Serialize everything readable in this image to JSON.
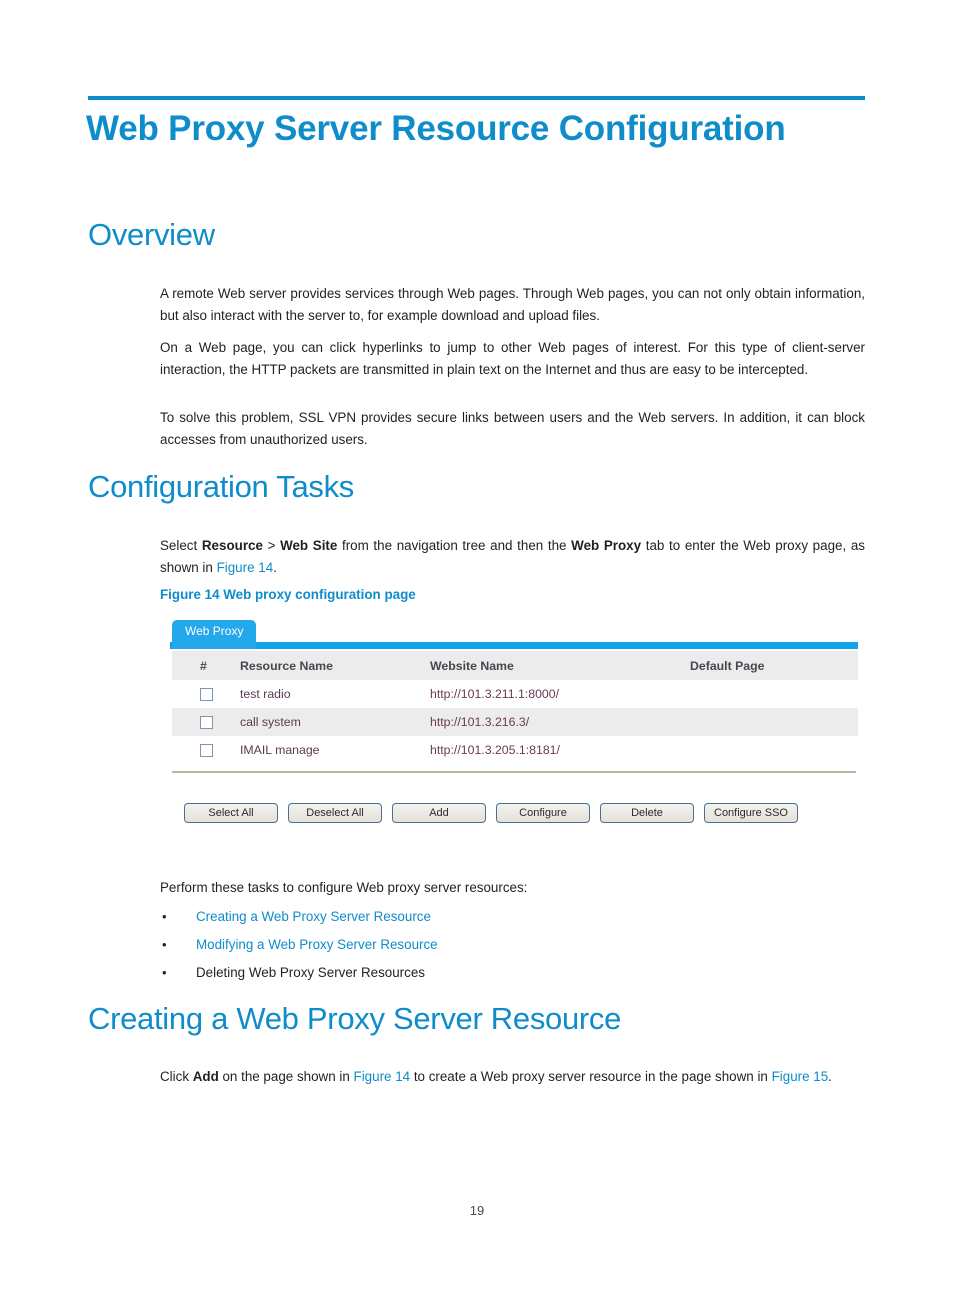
{
  "document": {
    "chapter_title": "Web Proxy Server Resource Configuration",
    "page_number": "19",
    "accent_color": "#0f8cca",
    "body_color": "#231f20"
  },
  "sections": {
    "overview": {
      "heading": "Overview",
      "paragraph_1": "A remote Web server provides services through Web pages. Through Web pages, you can not only obtain information, but also interact with the server to, for example download and upload files.",
      "paragraph_2": "On a Web page, you can click hyperlinks to jump to other Web pages of interest. For this type of client-server interaction, the HTTP packets are transmitted in plain text on the Internet and thus are easy to be intercepted.",
      "paragraph_3": "To solve this problem, SSL VPN provides secure links between users and the Web servers. In addition, it can block accesses from unauthorized users."
    },
    "configuration_tasks": {
      "heading": "Configuration Tasks",
      "intro_prefix": "Select ",
      "intro_bold_1": "Resource",
      "intro_sep": " > ",
      "intro_bold_2": "Web Site",
      "intro_mid": " from the navigation tree and then the ",
      "intro_bold_3": "Web Proxy",
      "intro_suffix": " tab to enter the Web proxy page, as shown in ",
      "intro_xref": "Figure 14",
      "intro_end": ".",
      "figure_caption": "Figure 14 Web proxy configuration page",
      "perform_text": "Perform these tasks to configure Web proxy server resources:",
      "task_links": [
        {
          "label": "Creating a Web Proxy Server Resource",
          "is_link": true
        },
        {
          "label": "Modifying a Web Proxy Server Resource",
          "is_link": true
        },
        {
          "label": "Deleting Web Proxy Server Resources",
          "is_link": false
        }
      ],
      "bullet_glyph": "•"
    },
    "creating": {
      "heading": "Creating a Web Proxy Server Resource",
      "body_prefix": "Click ",
      "body_bold": "Add",
      "body_mid": " on the page shown in ",
      "body_xref_1": "Figure 14",
      "body_mid_2": " to create a Web proxy server resource in the page shown in ",
      "body_xref_2": "Figure 15",
      "body_end": "."
    }
  },
  "figure": {
    "tab_label": "Web Proxy",
    "tab_color": "#23a8ec",
    "bar_color": "#13a3eb",
    "columns": [
      "#",
      "Resource Name",
      "Website Name",
      "Default Page"
    ],
    "rows": [
      {
        "checked": false,
        "resource_name": "test radio",
        "website_name": "http://101.3.211.1:8000/",
        "default_page": ""
      },
      {
        "checked": false,
        "resource_name": "call system",
        "website_name": "http://101.3.216.3/",
        "default_page": ""
      },
      {
        "checked": false,
        "resource_name": "IMAIL manage",
        "website_name": "http://101.3.205.1:8181/",
        "default_page": ""
      }
    ],
    "buttons": [
      "Select All",
      "Deselect All",
      "Add",
      "Configure",
      "Delete",
      "Configure SSO"
    ]
  }
}
